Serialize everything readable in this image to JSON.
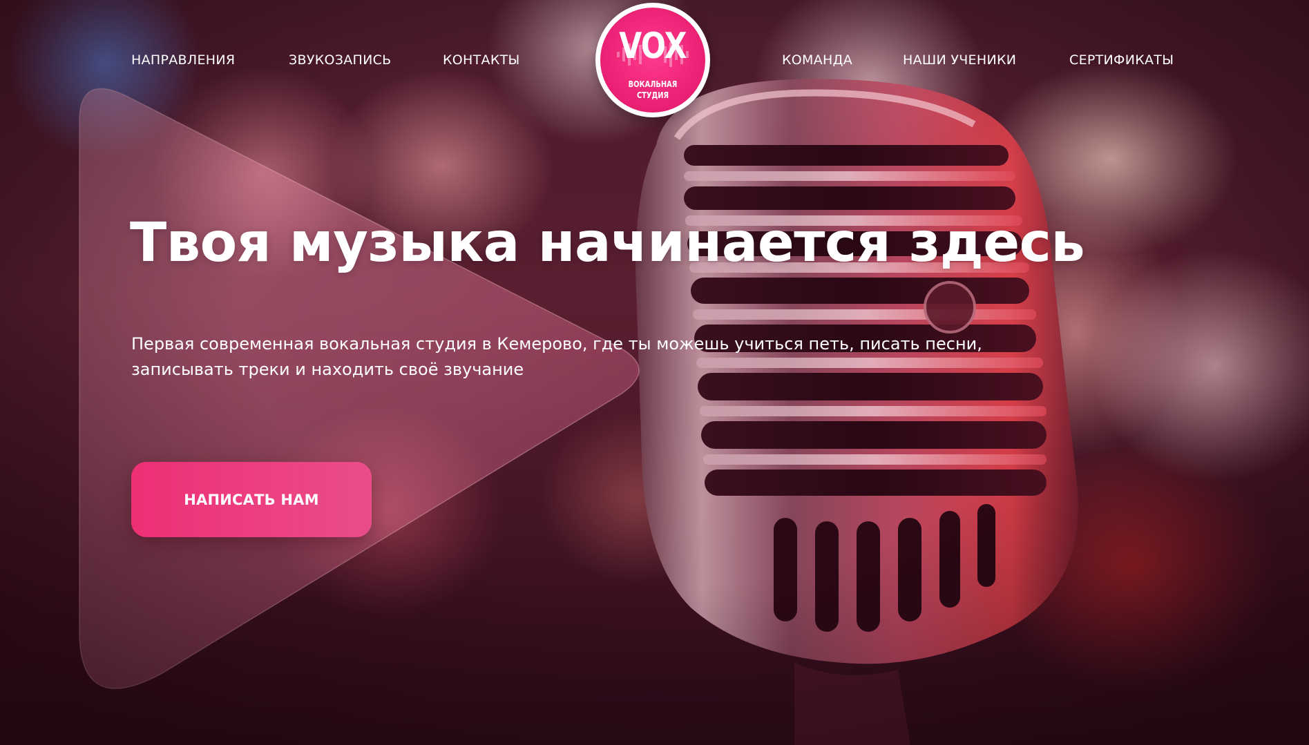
{
  "nav_left": [
    {
      "label": "НАПРАВЛЕНИЯ"
    },
    {
      "label": "ЗВУКОЗАПИСЬ"
    },
    {
      "label": "КОНТАКТЫ"
    }
  ],
  "nav_right": [
    {
      "label": "КОМАНДА"
    },
    {
      "label": "НАШИ УЧЕНИКИ"
    },
    {
      "label": "СЕРТИФИКАТЫ"
    }
  ],
  "logo": {
    "word": "VOX",
    "line1": "ВОКАЛЬНАЯ",
    "line2": "СТУДИЯ"
  },
  "hero": {
    "title": "Твоя музыка начинается здесь",
    "subtitle_line1": "Первая современная вокальная студия в Кемерово, где ты можешь учиться петь, писать песни,",
    "subtitle_line2": "записывать треки и находить своё звучание",
    "cta_label": "НАПИСАТЬ НАМ"
  },
  "colors": {
    "accent": "#ee2f76",
    "logo_pink": "#e81f72",
    "text": "#ffffff"
  }
}
